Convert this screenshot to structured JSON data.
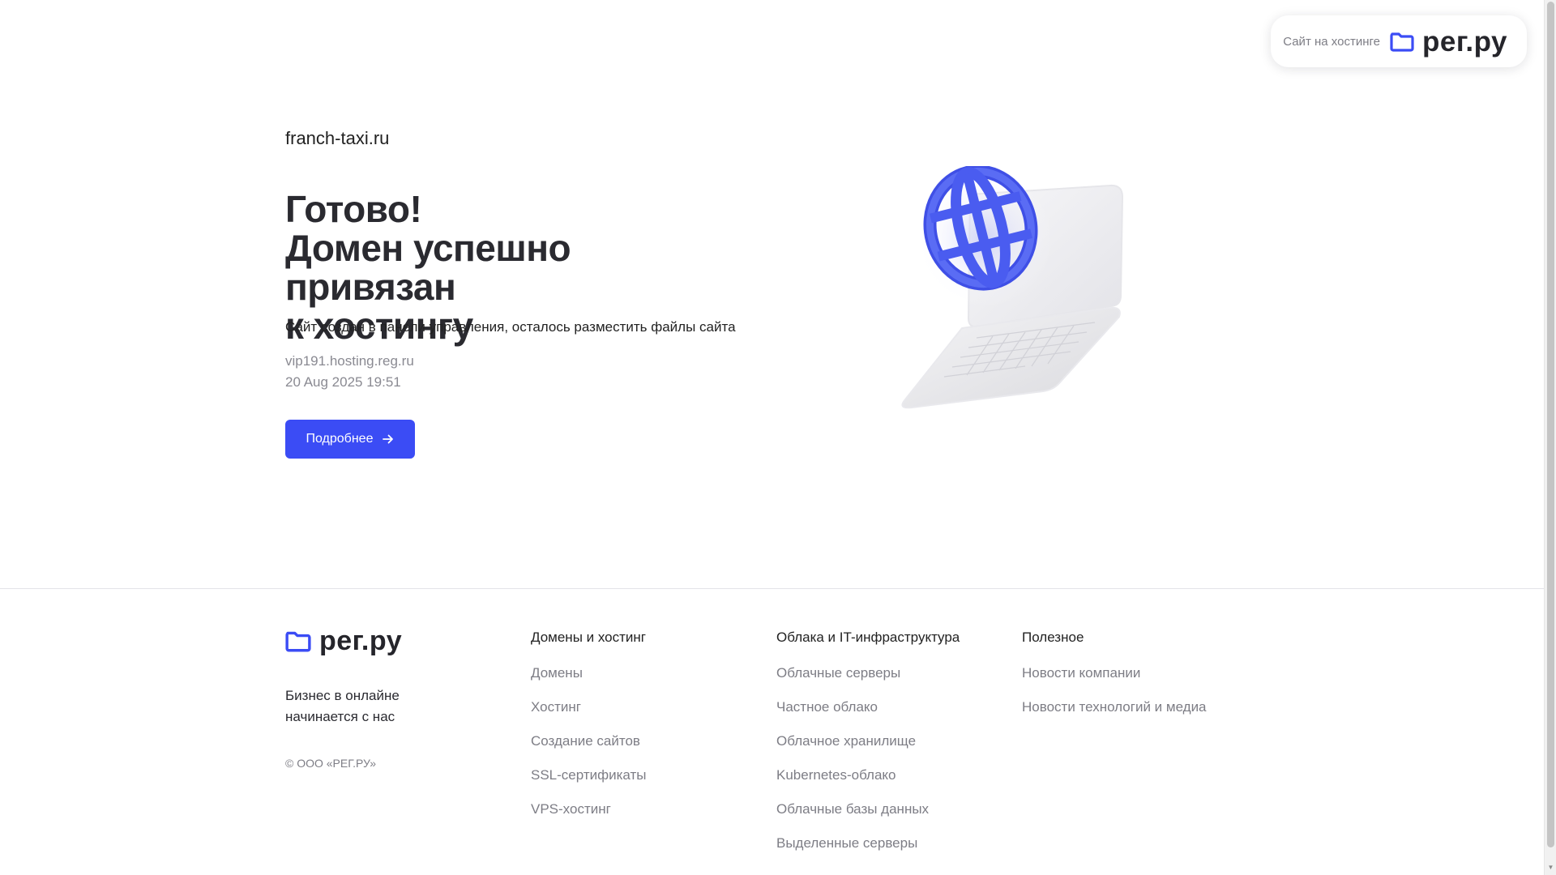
{
  "badge": {
    "text": "Сайт на хостинге",
    "logo_text": "рег.ру",
    "logo_icon": "folder-icon"
  },
  "hero": {
    "domain": "franch-taxi.ru",
    "title_lines": [
      "Готово!",
      "Домен успешно привязан",
      "к хостингу"
    ],
    "subtitle": "Сайт создан в панели управления, осталось разместить файлы сайта",
    "server": "vip191.hosting.reg.ru",
    "datetime": "20 Aug 2025 19:51",
    "button_label": "Подробнее",
    "button_icon": "arrow-right-icon",
    "illustration": "laptop-globe-illustration"
  },
  "footer": {
    "logo_text": "рег.ру",
    "tagline": "Бизнес в онлайне начинается с нас",
    "copyright": "© ООО «РЕГ.РУ»",
    "columns": [
      {
        "title": "Домены и хостинг",
        "links": [
          "Домены",
          "Хостинг",
          "Создание сайтов",
          "SSL-сертификаты",
          "VPS-хостинг"
        ]
      },
      {
        "title": "Облака и IT-инфраструктура",
        "links": [
          "Облачные серверы",
          "Частное облако",
          "Облачное хранилище",
          "Kubernetes-облако",
          "Облачные базы данных",
          "Выделенные серверы"
        ]
      },
      {
        "title": "Полезное",
        "links": [
          "Новости компании",
          "Новости технологий и медиа"
        ]
      }
    ]
  },
  "colors": {
    "accent": "#3b4cf5",
    "text_primary": "#2a2a30",
    "text_muted": "#7d7d85",
    "globe": "#4a5cf0"
  }
}
